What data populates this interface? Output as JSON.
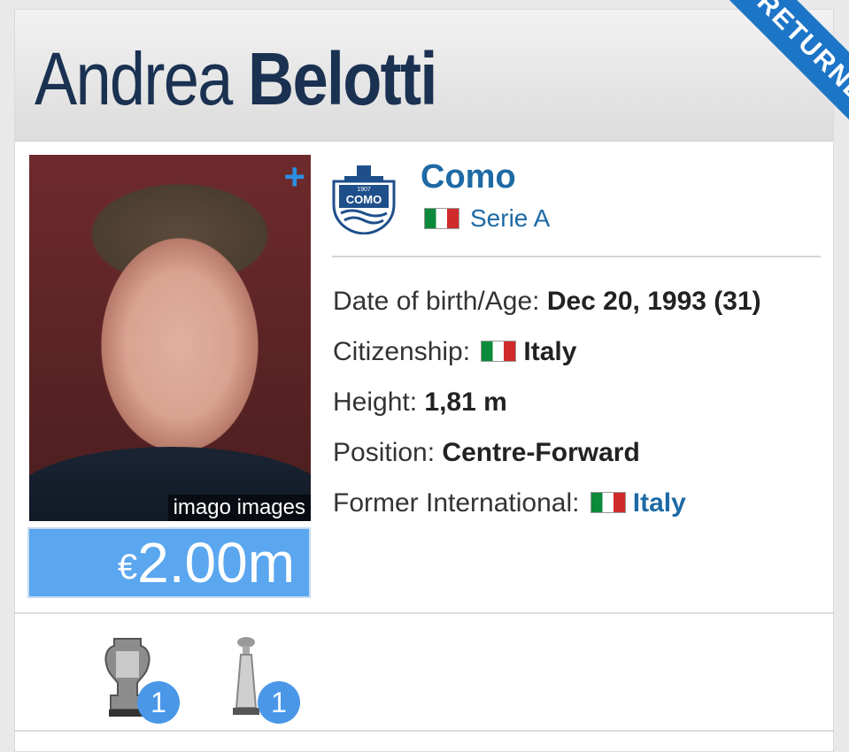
{
  "player": {
    "first_name": "Andrea",
    "last_name": "Belotti",
    "ribbon": "RETURNEE",
    "photo_credit": "imago images",
    "photo_expand": "+",
    "market_value": {
      "currency": "€",
      "amount": "2.00m"
    }
  },
  "club": {
    "name": "Como",
    "logo_text": "COMO",
    "logo_year": "1907",
    "league": "Serie A",
    "league_flag": "italy-flag"
  },
  "info": {
    "dob_label": "Date of birth/Age:",
    "dob_value": "Dec 20, 1993 (31)",
    "citizenship_label": "Citizenship:",
    "citizenship_value": "Italy",
    "height_label": "Height:",
    "height_value": "1,81 m",
    "position_label": "Position:",
    "position_value": "Centre-Forward",
    "intl_label": "Former International:",
    "intl_value": "Italy"
  },
  "trophies": [
    {
      "icon": "euro-championship-trophy-icon",
      "count": "1"
    },
    {
      "icon": "cup-trophy-icon",
      "count": "1"
    }
  ],
  "colors": {
    "name": "#1a3151",
    "link": "#1d6aa5",
    "ribbon": "#1d75c8",
    "value_box": "#5aa6ef",
    "badge": "#4a97e8"
  }
}
